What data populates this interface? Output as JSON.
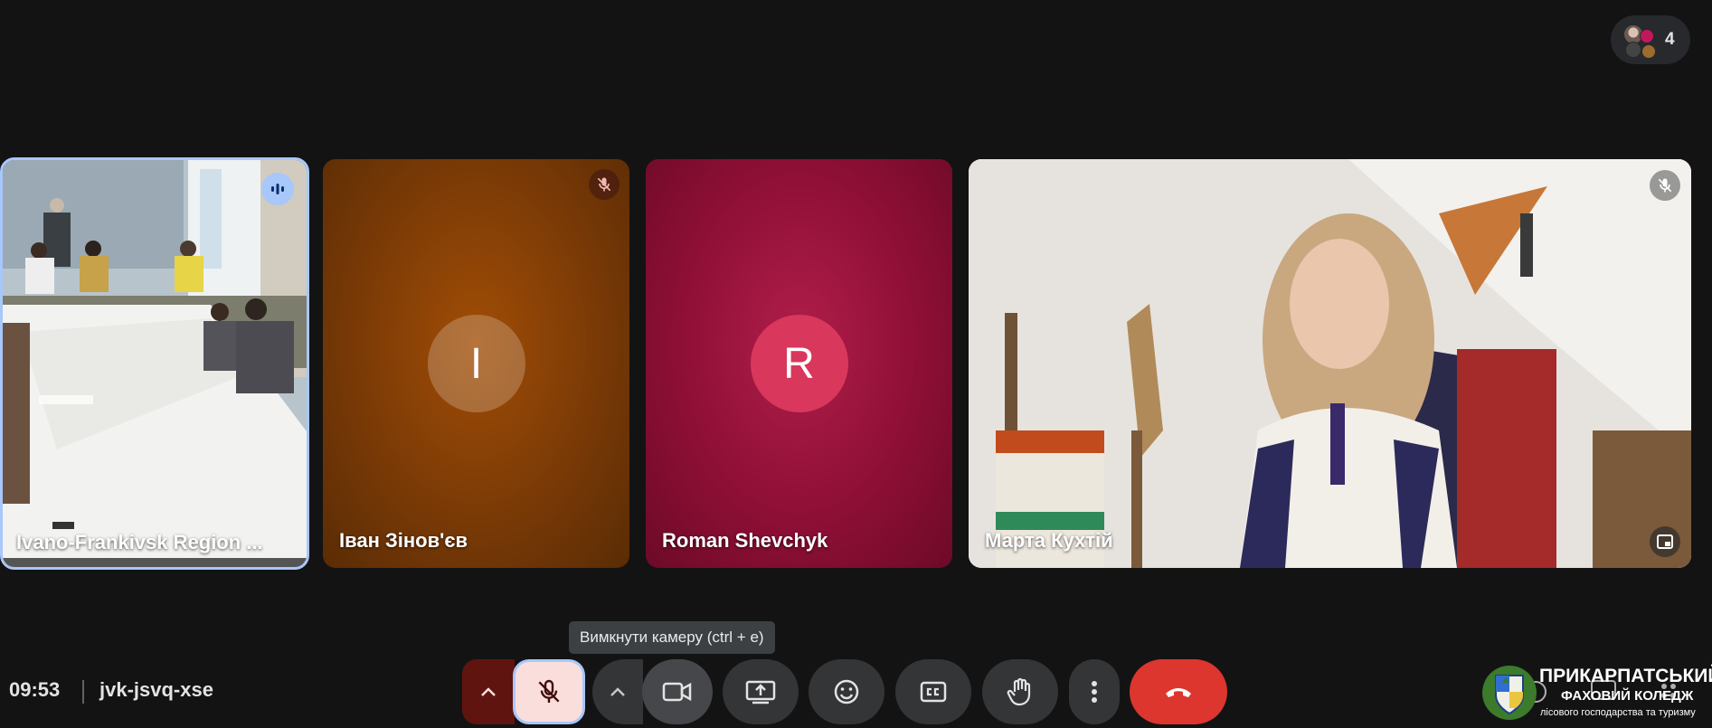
{
  "participants": {
    "count": "4"
  },
  "tiles": [
    {
      "name": "Ivano-Frankivsk Region ...",
      "state": "video",
      "speaking": true
    },
    {
      "name": "Іван Зінов'єв",
      "initial": "I",
      "muted": true,
      "bg": "#7a3a06"
    },
    {
      "name": "Roman Shevchyk",
      "initial": "R",
      "muted": false,
      "bg": "#8e0f36"
    },
    {
      "name": "Марта Кухтій",
      "state": "video",
      "muted": true
    }
  ],
  "tooltip": "Вимкнути камеру (ctrl + e)",
  "meeting": {
    "time": "09:53",
    "code": "jvk-jsvq-xse"
  },
  "controls": {
    "mic": "mic-off-icon",
    "camera": "videocam-icon",
    "present": "present-screen-icon",
    "reactions": "emoji-icon",
    "captions": "closed-captions-icon",
    "hand": "raise-hand-icon",
    "more": "more-vert-icon",
    "end": "call-end-icon"
  },
  "colors": {
    "end_call": "#dc362e",
    "mic_off_bg": "#f9dedc",
    "focus_ring": "#a8c7fa",
    "speaking": "#a8c7fa"
  },
  "college": {
    "line1": "ПРИКАРПАТСЬКИЙ",
    "line2": "ФАХОВИЙ КОЛЕДЖ",
    "line3": "лісового господарства та туризму"
  }
}
